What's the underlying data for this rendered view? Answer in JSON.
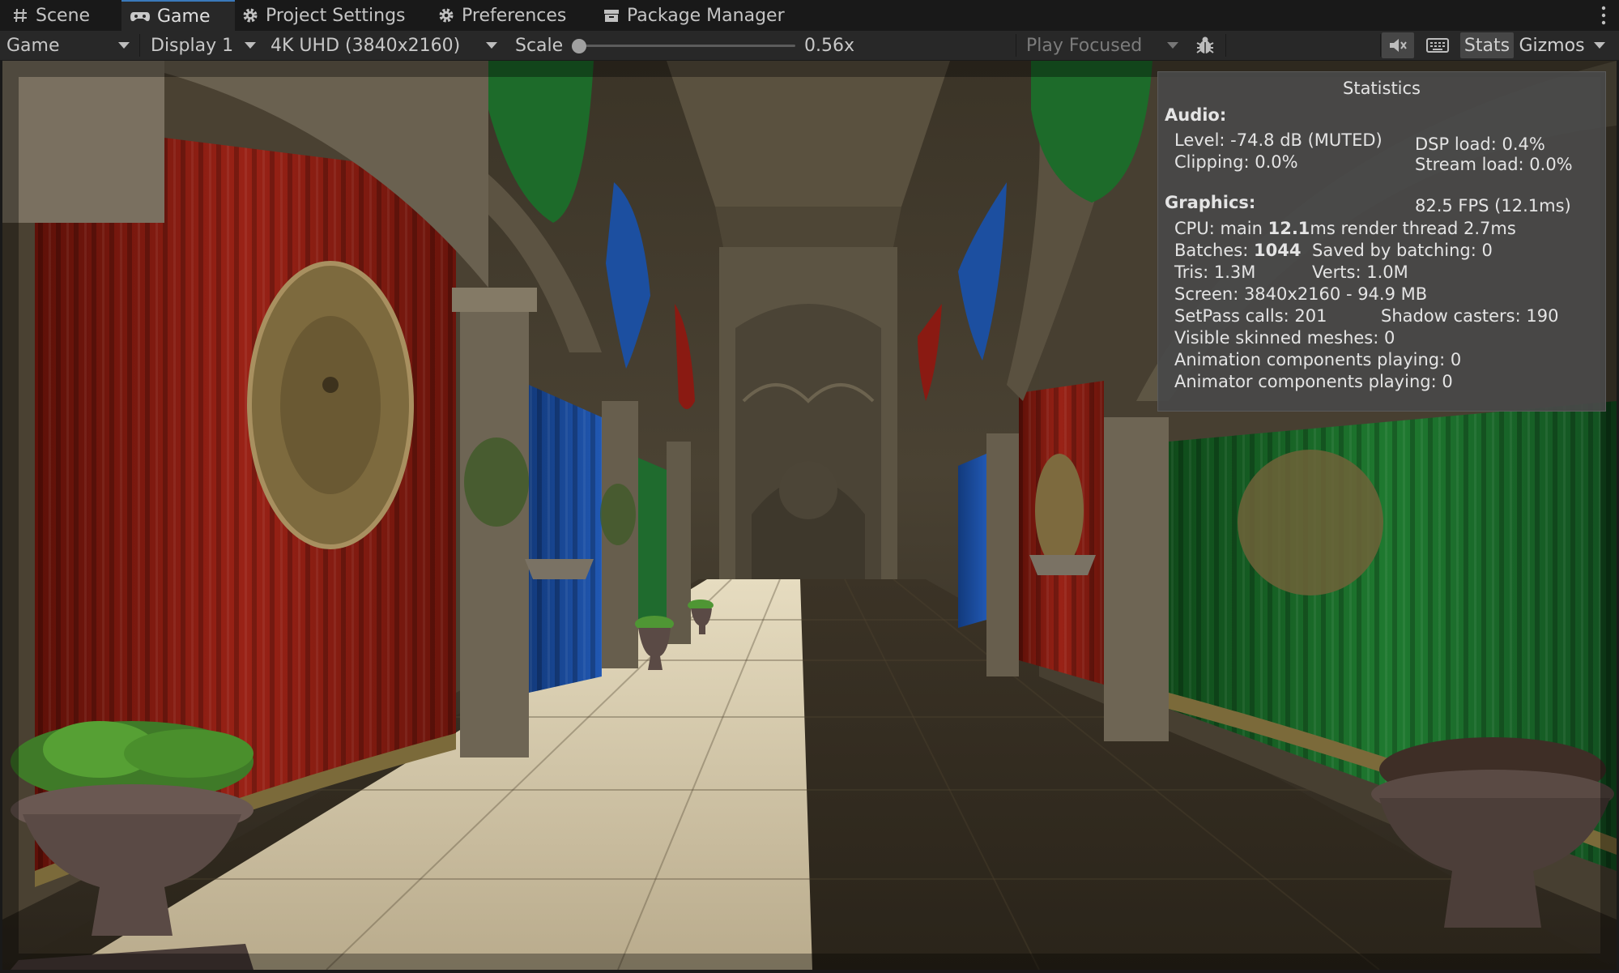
{
  "tabs": [
    {
      "label": "Scene",
      "icon": "hash-icon"
    },
    {
      "label": "Game",
      "icon": "gamepad-icon"
    },
    {
      "label": "Project Settings",
      "icon": "gear-icon"
    },
    {
      "label": "Preferences",
      "icon": "gear-icon"
    },
    {
      "label": "Package Manager",
      "icon": "package-icon"
    }
  ],
  "toolbar": {
    "view_mode": "Game",
    "display": "Display 1",
    "resolution": "4K UHD (3840x2160)",
    "scale_label": "Scale",
    "scale_value": "0.56x",
    "scale_fraction": 0.0,
    "play_mode": "Play Focused",
    "stats_label": "Stats",
    "gizmos_label": "Gizmos",
    "icons": [
      "bug-icon",
      "mute-audio-icon",
      "keyboard-icon"
    ]
  },
  "stats": {
    "title": "Statistics",
    "audio_header": "Audio:",
    "level": "Level: -74.8 dB (MUTED)",
    "clipping": "Clipping: 0.0%",
    "dsp": "DSP load: 0.4%",
    "stream": "Stream load: 0.0%",
    "graphics_header": "Graphics:",
    "fps": "82.5 FPS (12.1ms)",
    "cpu_prefix": "CPU: main ",
    "cpu_main": "12.1",
    "cpu_suffix": "ms  render thread 2.7ms",
    "batches_prefix": "Batches: ",
    "batches_value": "1044",
    "saved_batching": "Saved by batching: 0",
    "tris": "Tris: 1.3M",
    "verts": "Verts: 1.0M",
    "screen": "Screen: 3840x2160 - 94.9 MB",
    "setpass": "SetPass calls: 201",
    "shadow": "Shadow casters: 190",
    "skinned": "Visible skinned meshes: 0",
    "animation": "Animation components playing: 0",
    "animator": "Animator components playing: 0"
  },
  "colors": {
    "accent": "#3a79bb",
    "panel_bg": "#282828",
    "curtain_red": "#8a1a12",
    "curtain_green": "#1d6b2a",
    "curtain_blue": "#1c4fa0"
  }
}
